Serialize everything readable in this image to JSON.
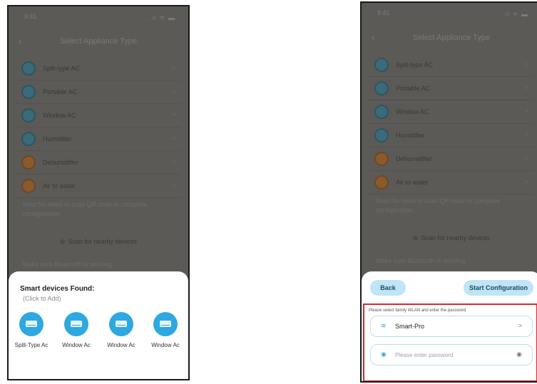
{
  "status": {
    "time": "9:41",
    "signal": "..ıl ᯤ ▬"
  },
  "nav": {
    "title": "Select Appliance Type",
    "back_glyph": "‹"
  },
  "appliances": [
    {
      "label": "Split-type AC",
      "color": "blue"
    },
    {
      "label": "Portable AC",
      "color": "blue"
    },
    {
      "label": "Window AC",
      "color": "blue"
    },
    {
      "label": "Humidifier",
      "color": "blue"
    },
    {
      "label": "Dehumidifier",
      "color": "orange"
    },
    {
      "label": "Air to water",
      "color": "orange"
    }
  ],
  "note": "Note:No need to scan QR code to complete configuration",
  "scan_label": "Scan for nearby devices",
  "bluetooth_note": "Make sure Bluetooth is working",
  "found": {
    "title": "Smart devices Found:",
    "subtitle": "(Click to Add)",
    "devices": [
      "Split-Type Ac",
      "Window Ac",
      "Window Ac",
      "Window Ac"
    ]
  },
  "config": {
    "back_label": "Back",
    "start_label": "Start Configuration",
    "hint": "Please select family WLAN and enter the password",
    "wifi_name": "Smart-Pro",
    "password_placeholder": "Please enter password"
  },
  "colors": {
    "accent": "#2ea8e0",
    "highlight": "#e0242b",
    "overlay": "#5b5a57"
  }
}
